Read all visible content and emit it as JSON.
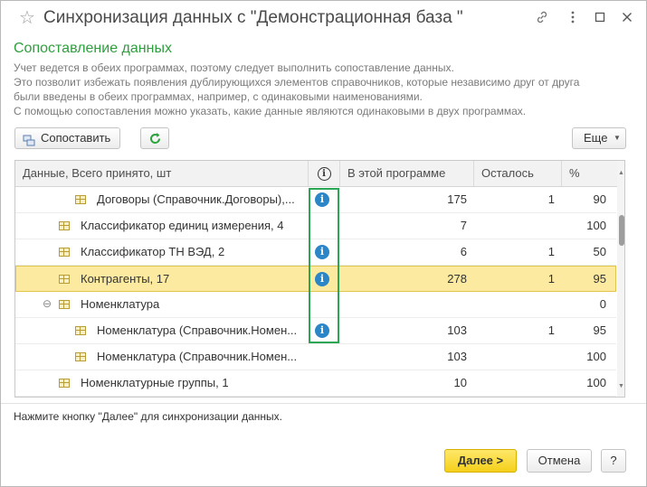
{
  "window": {
    "title": "Синхронизация данных с \"Демонстрационная база \"",
    "star_icon": "star-icon",
    "link_icon": "link-icon",
    "more_icon": "more-vertical-icon",
    "maximize_icon": "maximize-icon",
    "close_icon": "close-icon"
  },
  "section": {
    "title": "Сопоставление данных",
    "lines": [
      "Учет ведется в обеих программах, поэтому следует выполнить сопоставление данных.",
      "Это позволит избежать появления дублирующихся элементов справочников, которые независимо друг от друга",
      "были введены в обеих программах, например, с одинаковыми наименованиями.",
      "С помощью сопоставления можно указать, какие данные являются одинаковыми в двух программах."
    ]
  },
  "toolbar": {
    "compare_label": "Сопоставить",
    "refresh_icon": "refresh-icon",
    "more_label": "Еще"
  },
  "table": {
    "headers": {
      "data": "Данные, Всего принято, шт",
      "info": "i",
      "this_program": "В этой программе",
      "remaining": "Осталось",
      "percent": "%"
    },
    "rows": [
      {
        "name": "Договоры (Справочник.Договоры),...",
        "info": true,
        "this_program": "175",
        "remaining": "1",
        "percent": "90"
      },
      {
        "name": "Классификатор единиц измерения, 4",
        "info": false,
        "this_program": "7",
        "remaining": "",
        "percent": "100"
      },
      {
        "name": "Классификатор ТН ВЭД, 2",
        "info": true,
        "this_program": "6",
        "remaining": "1",
        "percent": "50"
      },
      {
        "name": "Контрагенты, 17",
        "info": true,
        "this_program": "278",
        "remaining": "1",
        "percent": "95"
      },
      {
        "name": "Номенклатура",
        "info": false,
        "this_program": "",
        "remaining": "",
        "percent": "0"
      },
      {
        "name": "Номенклатура (Справочник.Номен...",
        "info": true,
        "this_program": "103",
        "remaining": "1",
        "percent": "95"
      },
      {
        "name": "Номенклатура (Справочник.Номен...",
        "info": false,
        "this_program": "103",
        "remaining": "",
        "percent": "100"
      },
      {
        "name": "Номенклатурные группы, 1",
        "info": false,
        "this_program": "10",
        "remaining": "",
        "percent": "100"
      }
    ]
  },
  "footer": {
    "hint": "Нажмите кнопку \"Далее\" для синхронизации данных.",
    "next_label": "Далее >",
    "cancel_label": "Отмена",
    "help_label": "?"
  },
  "colors": {
    "accent_green": "#2f9e3f",
    "selected_row": "#fbeaa0",
    "info_blue": "#2b86c8",
    "primary_button": "#f4cf19"
  }
}
